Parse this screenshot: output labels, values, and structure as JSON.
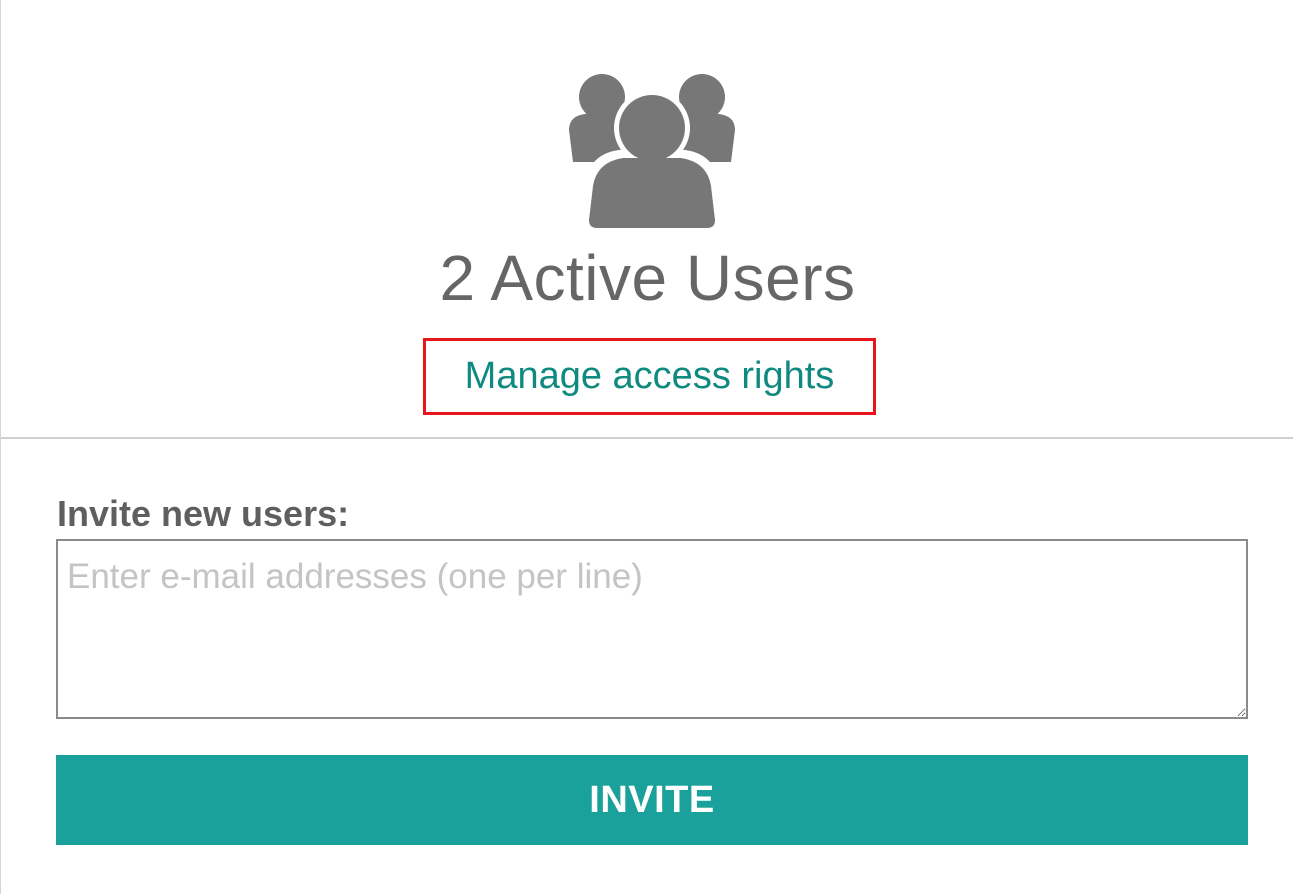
{
  "summary": {
    "icon": "users-group-icon",
    "icon_color": "#777777",
    "active_users_text": "2 Active Users",
    "manage_link_label": "Manage access rights"
  },
  "invite": {
    "label": "Invite new users:",
    "textarea_placeholder": "Enter e-mail addresses (one per line)",
    "textarea_value": "",
    "button_label": "INVITE"
  },
  "colors": {
    "accent": "#1aa19b",
    "link": "#0f8a80",
    "highlight_border": "#e8151b",
    "text_muted": "#666666"
  }
}
